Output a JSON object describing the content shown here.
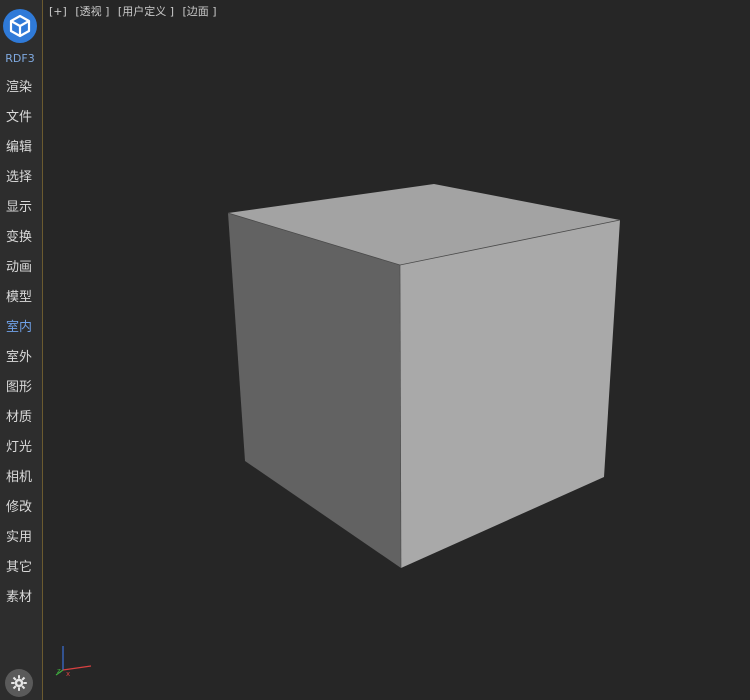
{
  "sidebar": {
    "brand": "RDF3",
    "items": [
      {
        "label": "渲染",
        "active": false
      },
      {
        "label": "文件",
        "active": false
      },
      {
        "label": "编辑",
        "active": false
      },
      {
        "label": "选择",
        "active": false
      },
      {
        "label": "显示",
        "active": false
      },
      {
        "label": "变换",
        "active": false
      },
      {
        "label": "动画",
        "active": false
      },
      {
        "label": "模型",
        "active": false
      },
      {
        "label": "室内",
        "active": true
      },
      {
        "label": "室外",
        "active": false
      },
      {
        "label": "图形",
        "active": false
      },
      {
        "label": "材质",
        "active": false
      },
      {
        "label": "灯光",
        "active": false
      },
      {
        "label": "相机",
        "active": false
      },
      {
        "label": "修改",
        "active": false
      },
      {
        "label": "实用",
        "active": false
      },
      {
        "label": "其它",
        "active": false
      },
      {
        "label": "素材",
        "active": false
      }
    ]
  },
  "viewport": {
    "labels": [
      "[+]",
      "[透视 ]",
      "[用户定义 ]",
      "[边面 ]"
    ]
  },
  "colors": {
    "accent": "#2f7ad8",
    "active_text": "#6fa0e6",
    "background": "#262626",
    "cube_top": "#a3a3a3",
    "cube_left": "#626262",
    "cube_right": "#a9a9a9"
  },
  "icons": {
    "logo": "brand-logo-icon",
    "settings": "gear-icon",
    "axis": "axis-gizmo-icon"
  }
}
